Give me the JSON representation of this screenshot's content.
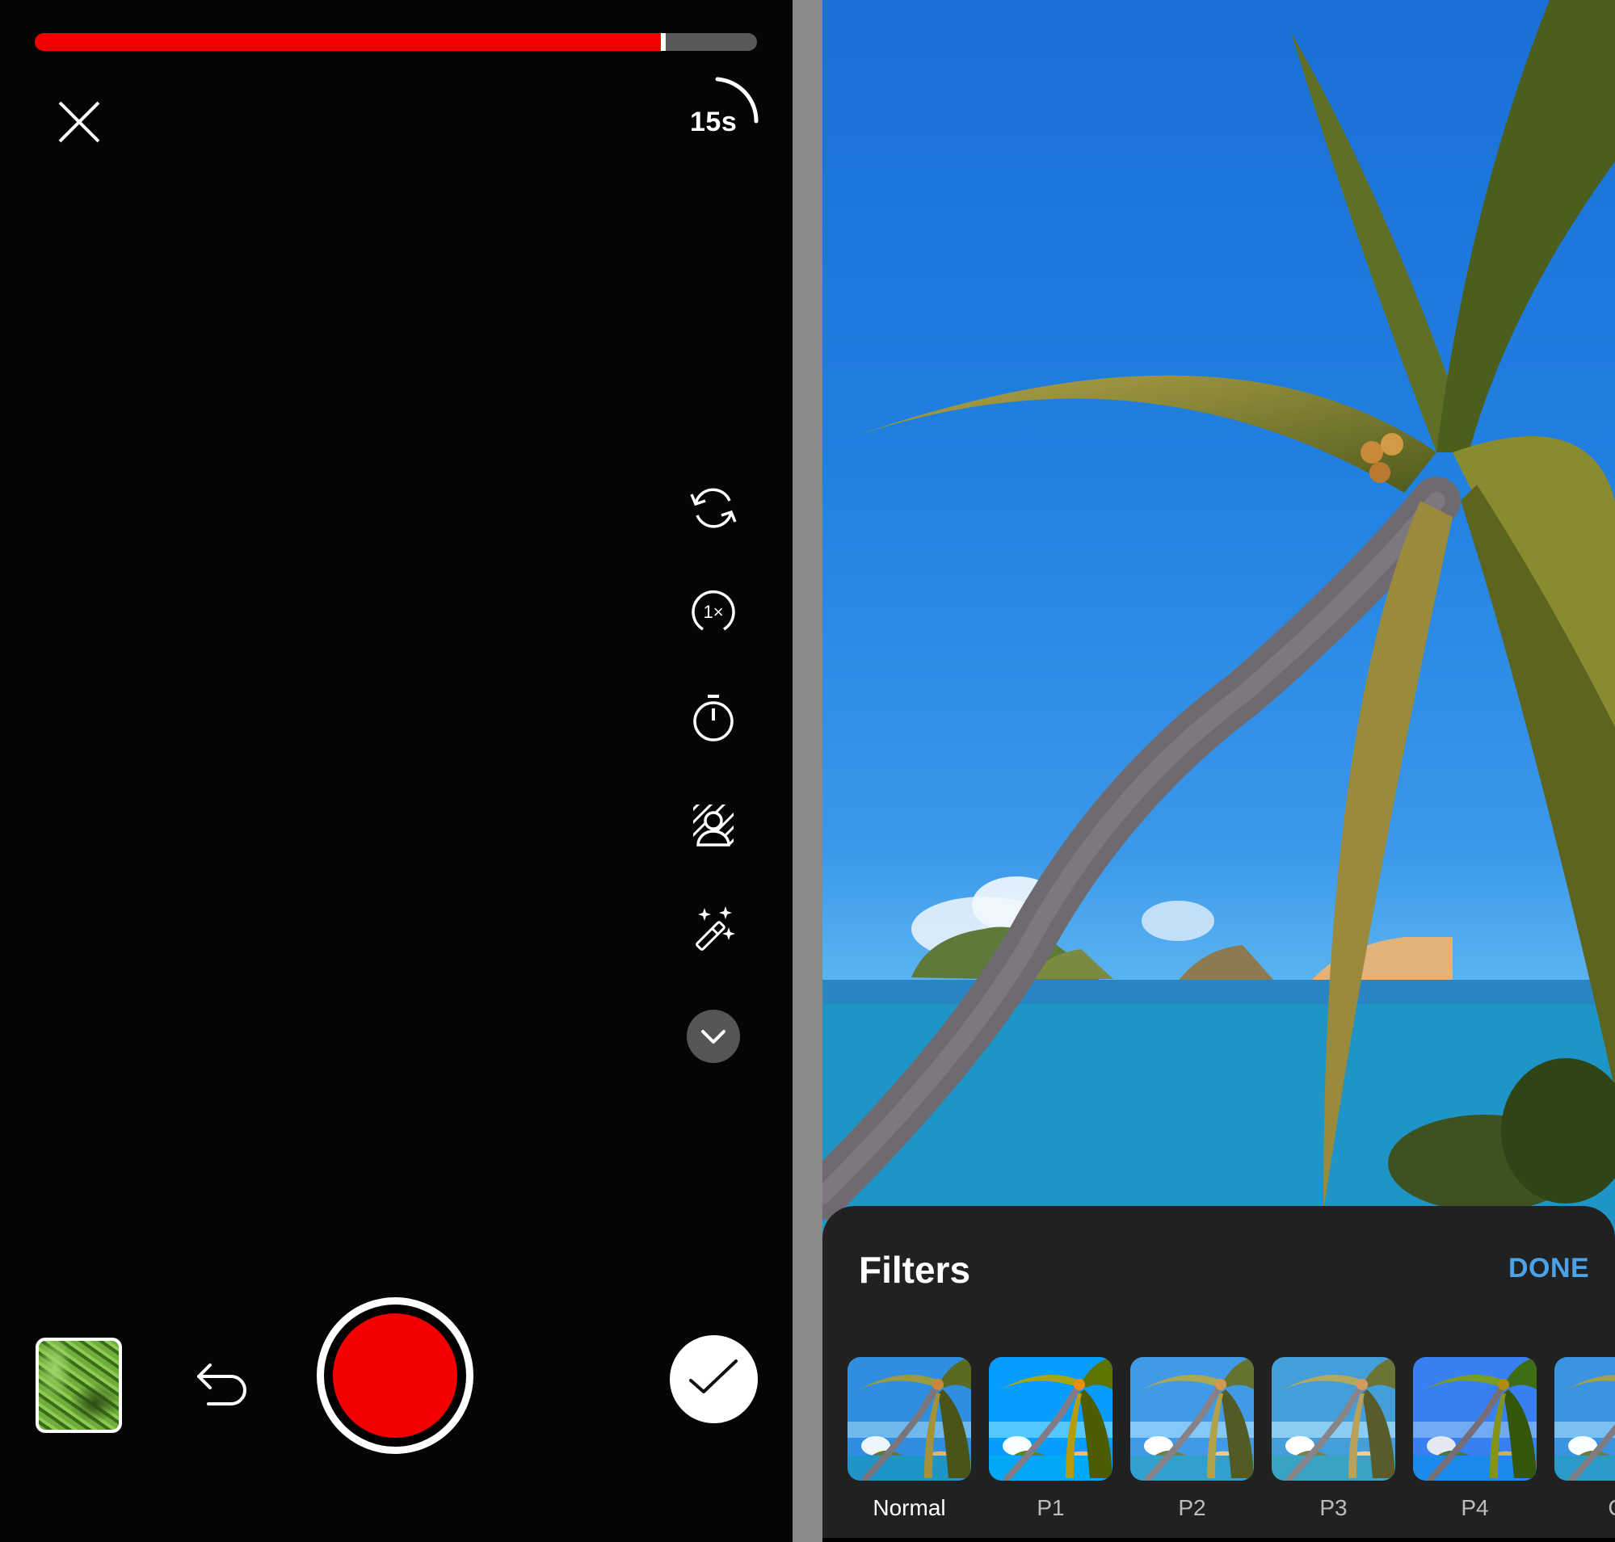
{
  "camera": {
    "recording_progress": 0.867,
    "duration_label": "15s",
    "icons": {
      "close": "close-icon",
      "duration": "duration-arc-icon",
      "flip_camera": "flip-camera-icon",
      "speed": "speed-1x-icon",
      "timer": "timer-icon",
      "green_screen": "green-screen-icon",
      "effects": "magic-wand-icon",
      "more": "chevron-down-icon",
      "undo": "undo-icon",
      "confirm": "checkmark-icon"
    },
    "speed_label": "1×",
    "colors": {
      "record": "#f50000",
      "progress_track": "#585858"
    }
  },
  "filters": {
    "title": "Filters",
    "done_label": "DONE",
    "accent": "#4aa3e8",
    "selected": "Normal",
    "items": [
      {
        "label": "Normal",
        "selected": true
      },
      {
        "label": "P1",
        "selected": false
      },
      {
        "label": "P2",
        "selected": false
      },
      {
        "label": "P3",
        "selected": false
      },
      {
        "label": "P4",
        "selected": false
      },
      {
        "label": "C",
        "selected": false
      }
    ]
  }
}
